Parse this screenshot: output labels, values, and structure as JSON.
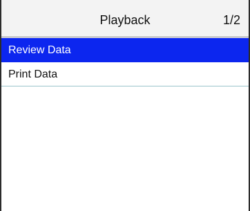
{
  "header": {
    "title": "Playback",
    "page_indicator": "1/2"
  },
  "menu": {
    "items": [
      {
        "label": "Review Data",
        "selected": true
      },
      {
        "label": "Print Data",
        "selected": false
      }
    ],
    "selected_color": "#0c26ef"
  }
}
